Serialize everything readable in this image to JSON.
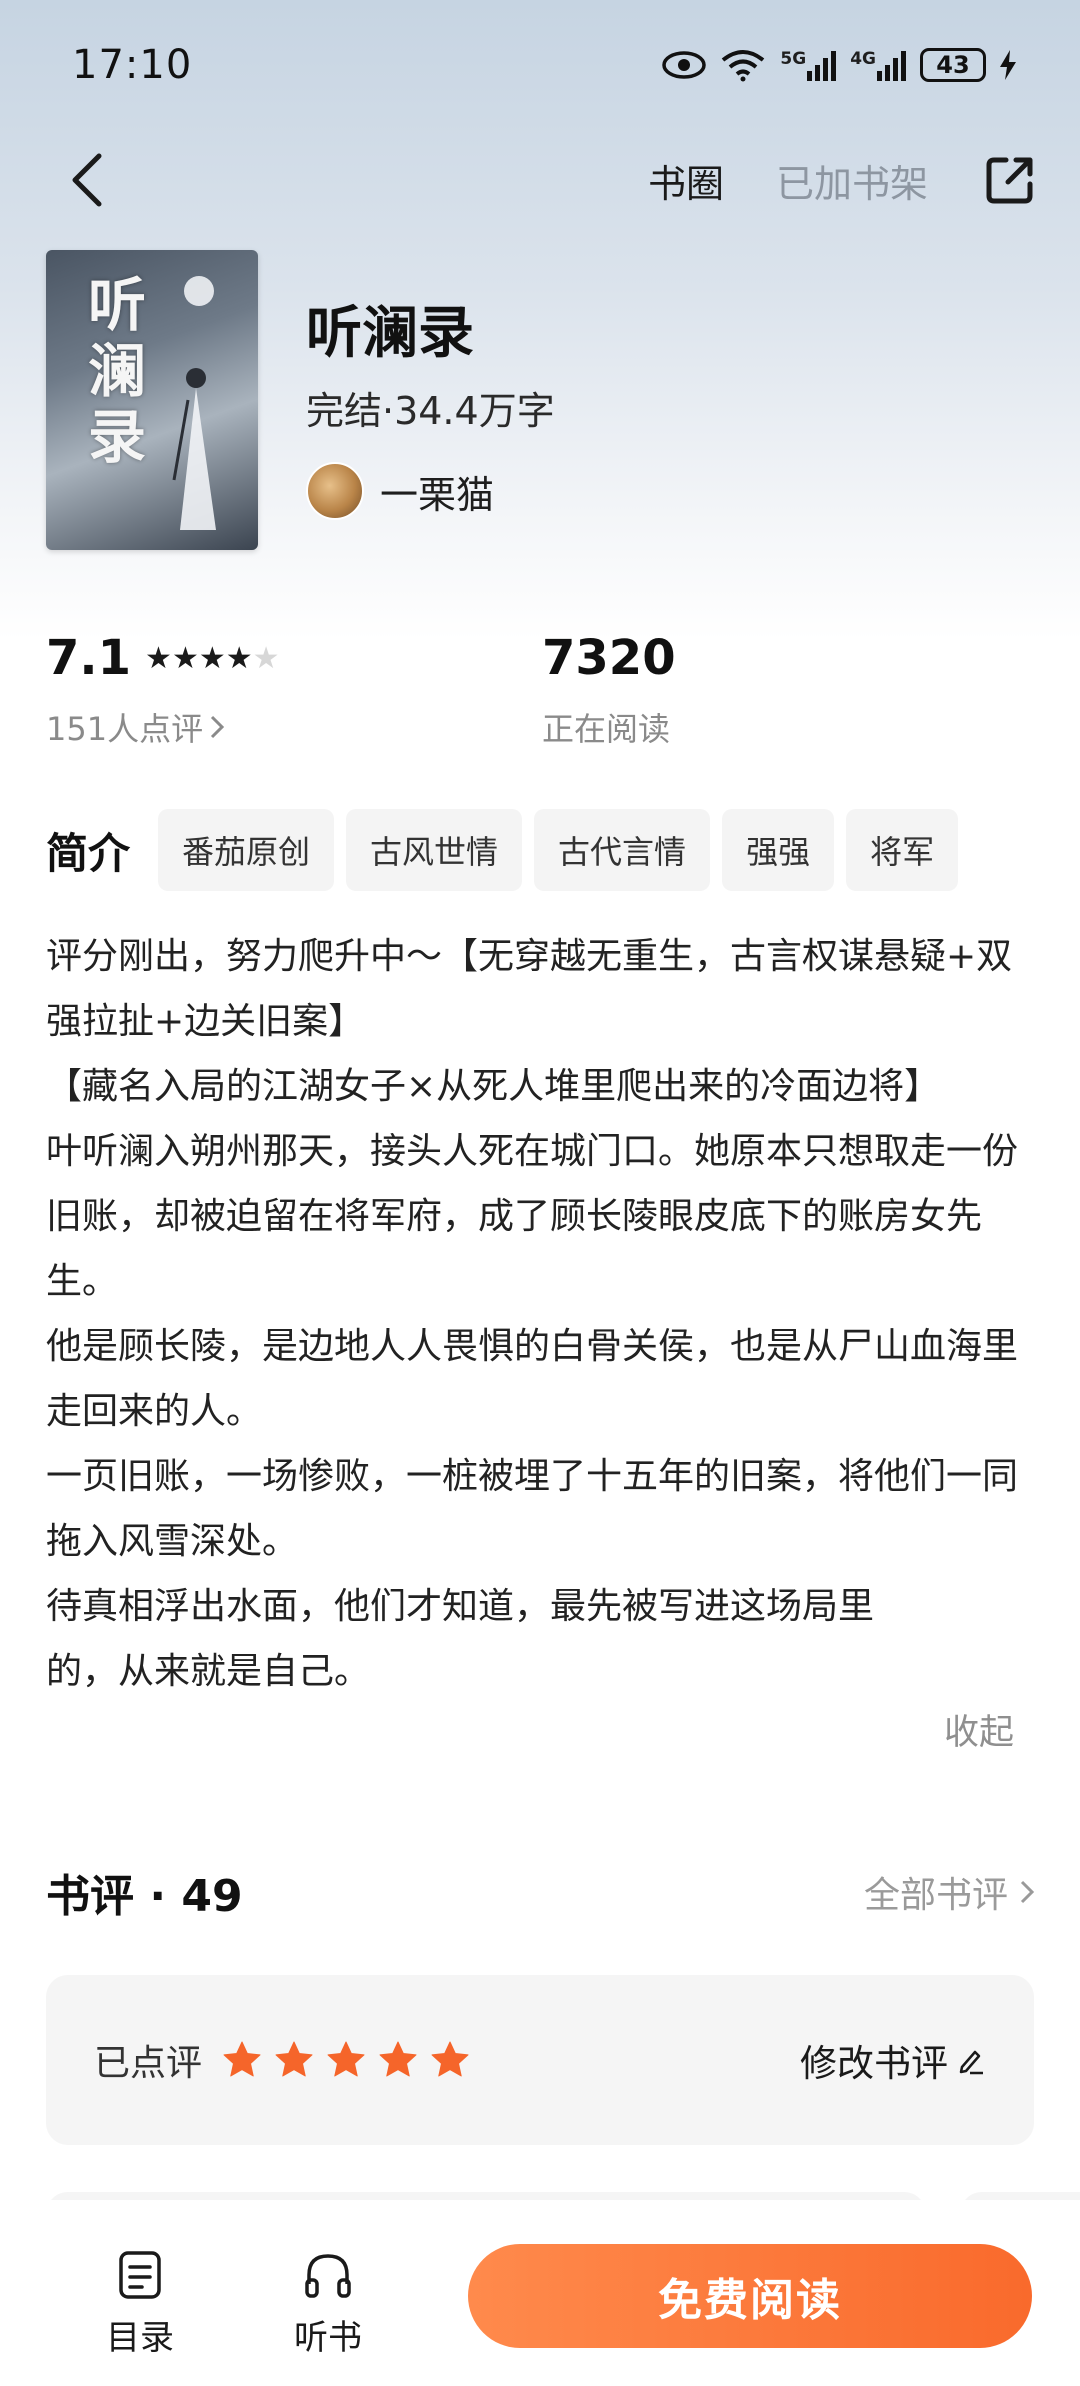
{
  "status_bar": {
    "time": "17:10",
    "signal1_label": "5G",
    "signal2_label": "4G",
    "battery": "43",
    "icons": [
      "eye-icon",
      "wifi-icon",
      "signal-5g-icon",
      "signal-4g-icon",
      "battery-icon",
      "charging-icon"
    ]
  },
  "nav": {
    "back_icon": "chevron-left-icon",
    "book_circle": "书圈",
    "shelf_status": "已加书架",
    "share_icon": "share-icon"
  },
  "book": {
    "cover_title": "听澜录",
    "title": "听澜录",
    "status": "完结·34.4万字",
    "author": "一栗猫"
  },
  "stats": {
    "score": "7.1",
    "stars_filled": 4,
    "stars_total": 5,
    "rating_count": "151人点评",
    "readers": "7320",
    "readers_label": "正在阅读"
  },
  "intro": {
    "heading": "简介",
    "tags": [
      "番茄原创",
      "古风世情",
      "古代言情",
      "强强",
      "将军"
    ]
  },
  "synopsis": {
    "paragraphs": [
      "评分刚出，努力爬升中～【无穿越无重生，古言权谋悬疑+双强拉扯+边关旧案】",
      "【藏名入局的江湖女子×从死人堆里爬出来的冷面边将】",
      "叶听澜入朔州那天，接头人死在城门口。她原本只想取走一份旧账，却被迫留在将军府，成了顾长陵眼皮底下的账房女先生。",
      "他是顾长陵，是边地人人畏惧的白骨关侯，也是从尸山血海里走回来的人。",
      "一页旧账，一场惨败，一桩被埋了十五年的旧案，将他们一同拖入风雪深处。",
      "待真相浮出水面，他们才知道，最先被写进这场局里的，从来就是自己。"
    ],
    "collapse": "收起"
  },
  "reviews": {
    "title": "书评 · 49",
    "all_link": "全部书评",
    "my_label": "已点评",
    "my_stars": 5,
    "edit_label": "修改书评"
  },
  "bottom": {
    "toc": "目录",
    "listen": "听书",
    "read_button": "免费阅读"
  },
  "colors": {
    "accent": "#f96a2c",
    "star": "#f5652a",
    "muted": "#8a8a8a"
  }
}
